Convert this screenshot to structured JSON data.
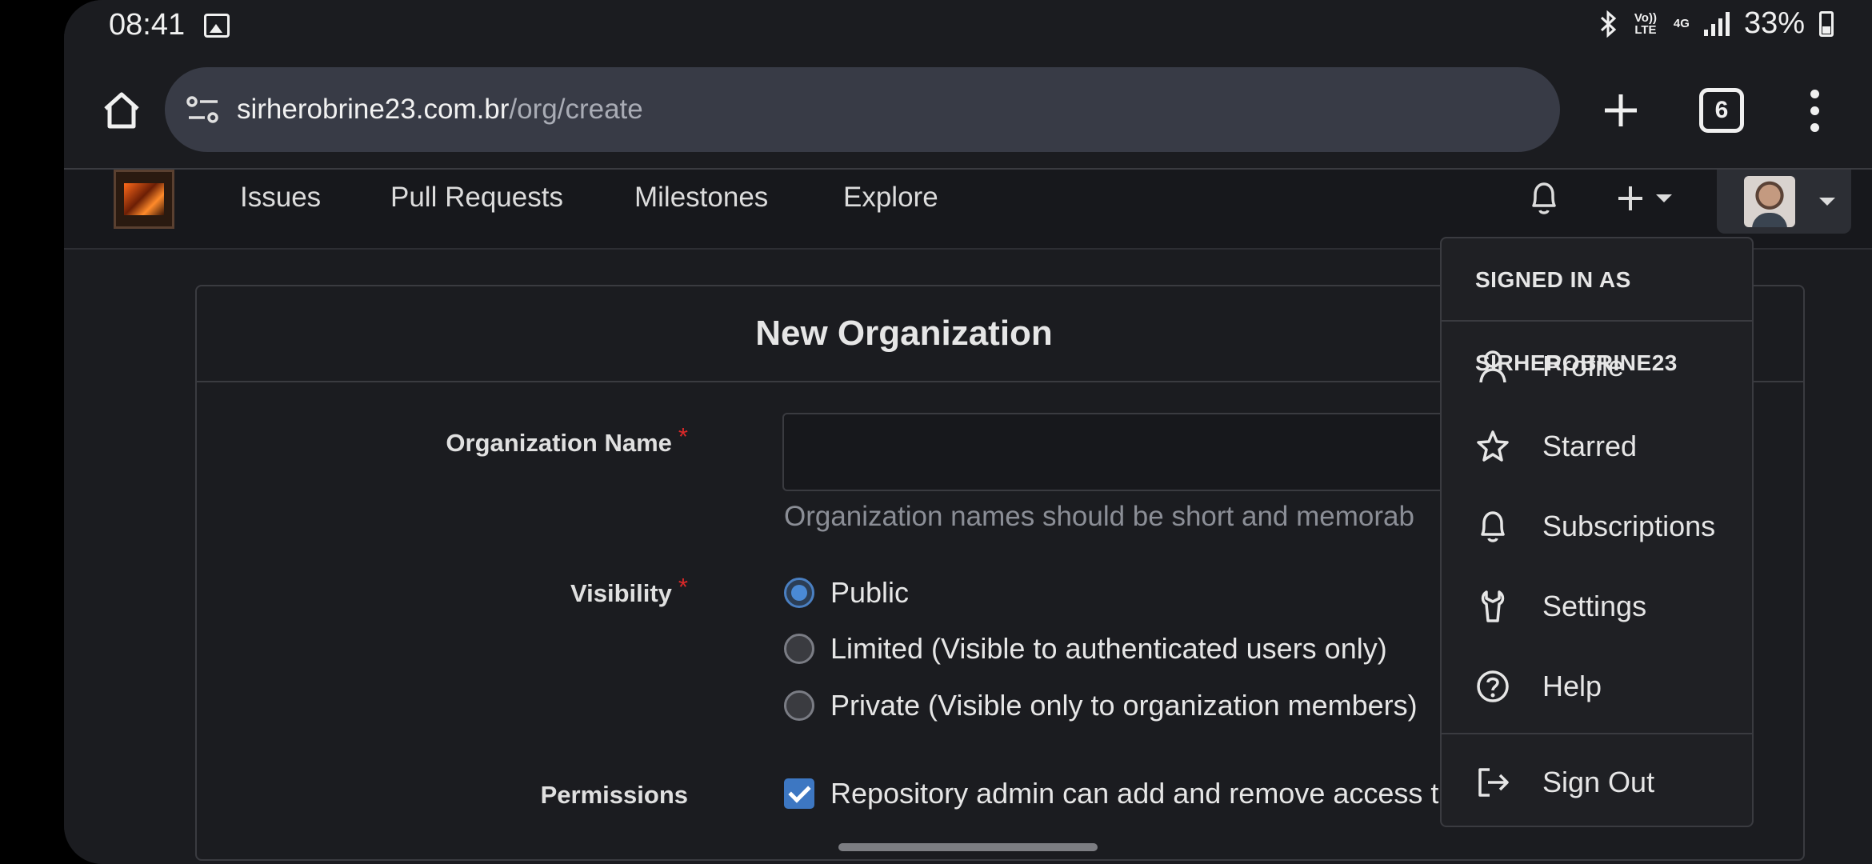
{
  "status_bar": {
    "time": "08:41",
    "network_small_1": "Vo)) LTE",
    "network_small_2": "4G",
    "battery": "33%"
  },
  "browser": {
    "url_host": "sirherobrine23.com.br",
    "url_path": "/org/create",
    "tab_count": "6"
  },
  "nav": {
    "items": [
      "Issues",
      "Pull Requests",
      "Milestones",
      "Explore"
    ]
  },
  "form": {
    "title": "New Organization",
    "name_label": "Organization Name",
    "required_mark": "*",
    "name_value": "",
    "name_help": "Organization names should be short and memorab",
    "visibility_label": "Visibility",
    "visibility_options": [
      "Public",
      "Limited (Visible to authenticated users only)",
      "Private (Visible only to organization members)"
    ],
    "visibility_selected": "Public",
    "permissions_label": "Permissions",
    "permissions_option": "Repository admin can add and remove access t",
    "permissions_checked": true
  },
  "user_menu": {
    "header": "SIGNED IN AS SIRHEROBRINE23",
    "items": [
      "Profile",
      "Starred",
      "Subscriptions",
      "Settings",
      "Help"
    ],
    "sign_out": "Sign Out"
  },
  "colors": {
    "accent": "#4a8ad6",
    "required": "#db2828",
    "background": "#1b1c20"
  }
}
